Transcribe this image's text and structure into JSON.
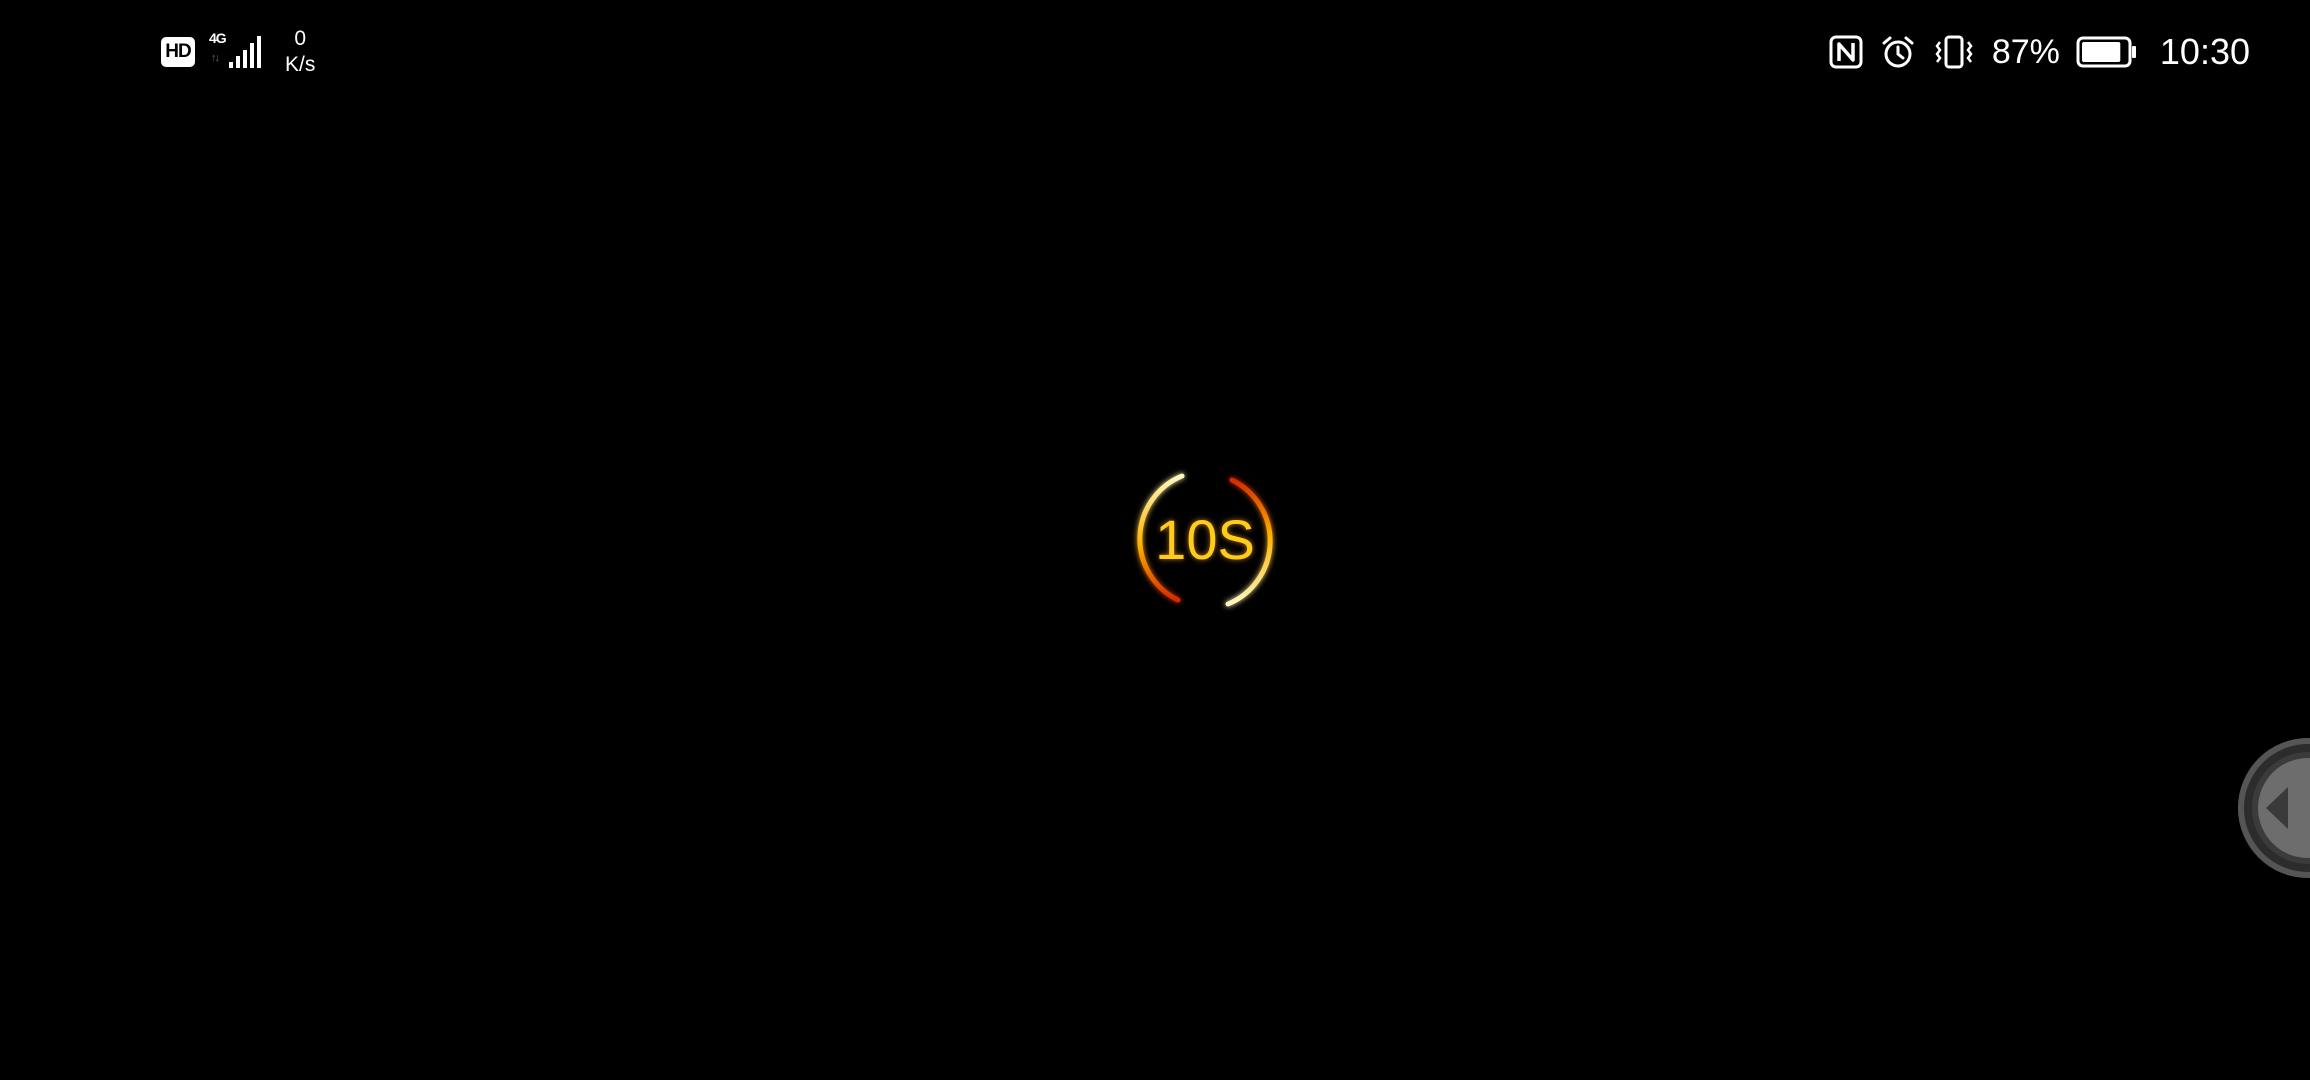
{
  "status_bar": {
    "hd_label": "HD",
    "network_type": "4G",
    "network_arrows": "↑↓",
    "speed_value": "0",
    "speed_unit": "K/s",
    "battery_percent": "87%",
    "battery_level": 0.87,
    "time": "10:30",
    "icons": [
      "nfc-icon",
      "alarm-icon",
      "vibrate-icon",
      "battery-icon"
    ]
  },
  "countdown": {
    "label": "10S",
    "color": "#ffcc1a",
    "ring_colors": [
      "#fff2a0",
      "#ffb300",
      "#d42a00"
    ]
  },
  "edge_button": {
    "icon": "arrow-left-icon"
  }
}
